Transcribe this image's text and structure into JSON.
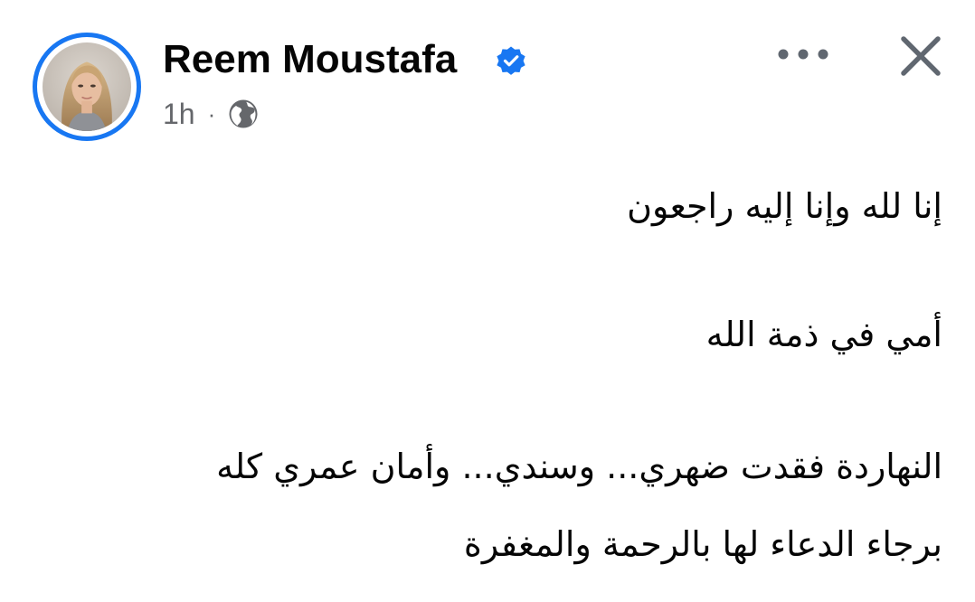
{
  "post": {
    "author": {
      "name": "Reem Moustafa",
      "verified": true
    },
    "time": "1h",
    "separator": "·",
    "audience_icon": "globe-icon",
    "lines": [
      "إنا لله وإنا إليه راجعون",
      "أمي في ذمة الله",
      "النهاردة فقدت ضهري... وسندي... وأمان عمري كله",
      "برجاء الدعاء لها بالرحمة والمغفرة"
    ]
  },
  "icons": {
    "more": "more-dots-icon",
    "close": "close-icon",
    "verified": "verified-badge-icon"
  },
  "colors": {
    "accent": "#1877f2",
    "text": "#050505",
    "secondary_text": "#65676b",
    "icon": "#606770"
  }
}
